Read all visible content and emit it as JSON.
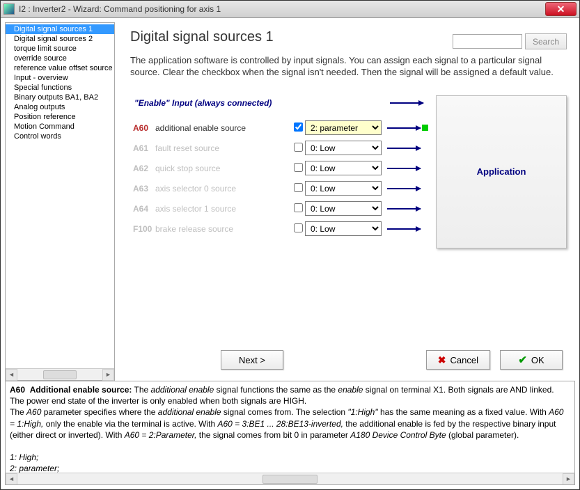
{
  "window": {
    "title": "I2 : Inverter2 - Wizard: Command positioning for axis 1"
  },
  "sidebar": {
    "items": [
      "Digital signal sources 1",
      "Digital signal sources 2",
      "torque limit source",
      "override source",
      "reference value offset source",
      "Input - overview",
      "Special functions",
      "Binary outputs BA1, BA2",
      "Analog outputs",
      "Position reference",
      "Motion Command",
      "Control words"
    ],
    "selected_index": 0
  },
  "search": {
    "placeholder": "",
    "button": "Search"
  },
  "page": {
    "title": "Digital signal sources 1",
    "description": "The application software is controlled by input signals. You can assign each signal to a particular signal source. Clear the checkbox when the signal isn't needed. Then the signal will be assigned a default value."
  },
  "enable_input_label": "\"Enable\" Input (always connected)",
  "rows": [
    {
      "pid": "A60",
      "label": "additional enable source",
      "checked": true,
      "value": "2: parameter",
      "active": true,
      "green": true
    },
    {
      "pid": "A61",
      "label": "fault reset source",
      "checked": false,
      "value": "0: Low",
      "active": false,
      "green": false
    },
    {
      "pid": "A62",
      "label": "quick stop source",
      "checked": false,
      "value": "0: Low",
      "active": false,
      "green": false
    },
    {
      "pid": "A63",
      "label": "axis selector 0 source",
      "checked": false,
      "value": "0: Low",
      "active": false,
      "green": false
    },
    {
      "pid": "A64",
      "label": "axis selector 1 source",
      "checked": false,
      "value": "0: Low",
      "active": false,
      "green": false
    },
    {
      "pid": "F100",
      "label": "brake release source",
      "checked": false,
      "value": "0: Low",
      "active": false,
      "green": false
    }
  ],
  "appbox": "Application",
  "buttons": {
    "next": "Next  >",
    "cancel": "Cancel",
    "ok": "OK"
  },
  "help": {
    "heading_pid": "A60",
    "heading_text": "Additional enable source:",
    "body1a": "The ",
    "body1b": "additional enable",
    "body1c": " signal functions the same as the ",
    "body1d": "enable",
    "body1e": " signal on terminal X1. Both signals are AND linked. The power end state of the inverter is only enabled when both signals are HIGH.",
    "body2a": "The ",
    "body2b": "A60",
    "body2c": " parameter specifies where the ",
    "body2d": "additional enable",
    "body2e": " signal comes from. The selection ",
    "body2f": "\"1:High\"",
    "body2g": " has the same meaning as a fixed value. With ",
    "body2h": "A60 = 1:High,",
    "body2i": " only the enable via the terminal is active. With ",
    "body2j": "A60 = 3:BE1 ... 28:BE13-inverted,",
    "body2k": " the additional enable is fed by the respective binary input (either direct or inverted). With ",
    "body2l": "A60 = 2:Parameter,",
    "body2m": " the signal comes from bit 0 in parameter ",
    "body2n": "A180 Device Control Byte",
    "body2o": " (global parameter).",
    "opt1": "1:  High;",
    "opt2": "2:  parameter;"
  }
}
